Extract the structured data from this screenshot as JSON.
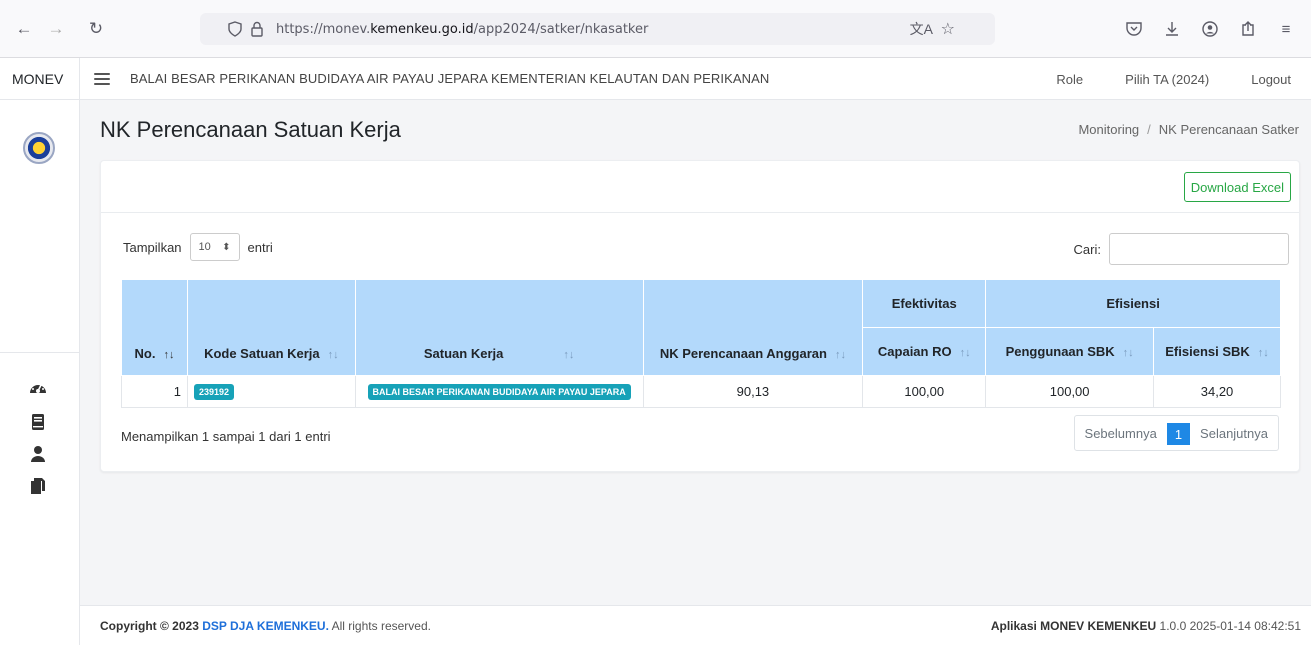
{
  "browser": {
    "url_prefix": "https://monev.",
    "url_host": "kemenkeu.go.id",
    "url_path": "/app2024/satker/nkasatker"
  },
  "header": {
    "brand": "MONEV",
    "org_name": "BALAI BESAR PERIKANAN BUDIDAYA AIR PAYAU JEPARA KEMENTERIAN KELAUTAN DAN PERIKANAN",
    "role": "Role",
    "pilih_ta": "Pilih TA (2024)",
    "logout": "Logout"
  },
  "page": {
    "title": "NK Perencanaan Satuan Kerja",
    "breadcrumb": [
      "Monitoring",
      "NK Perencanaan Satker"
    ],
    "download_label": "Download Excel",
    "show_label": "Tampilkan",
    "show_value": "10",
    "entries_label": "entri",
    "search_label": "Cari:"
  },
  "table": {
    "group_headers": [
      "Efektivitas",
      "Efisiensi"
    ],
    "columns": [
      "No.",
      "Kode Satuan Kerja",
      "Satuan Kerja",
      "NK Perencanaan Anggaran",
      "Capaian RO",
      "Penggunaan SBK",
      "Efisiensi SBK"
    ],
    "rows": [
      {
        "no": "1",
        "kode": "239192",
        "satker": "BALAI BESAR PERIKANAN BUDIDAYA AIR PAYAU JEPARA",
        "nk": "90,13",
        "capaian": "100,00",
        "penggunaan": "100,00",
        "efisiensi": "34,20"
      }
    ]
  },
  "footer_table": {
    "info": "Menampilkan 1 sampai 1 dari 1 entri",
    "prev": "Sebelumnya",
    "page": "1",
    "next": "Selanjutnya"
  },
  "footer": {
    "copy_prefix": "Copyright © 2023",
    "copy_link": "DSP DJA KEMENKEU.",
    "copy_suffix": "All rights reserved.",
    "app_name": "Aplikasi MONEV KEMENKEU",
    "version": "1.0.0 2025-01-14 08:42:51"
  }
}
